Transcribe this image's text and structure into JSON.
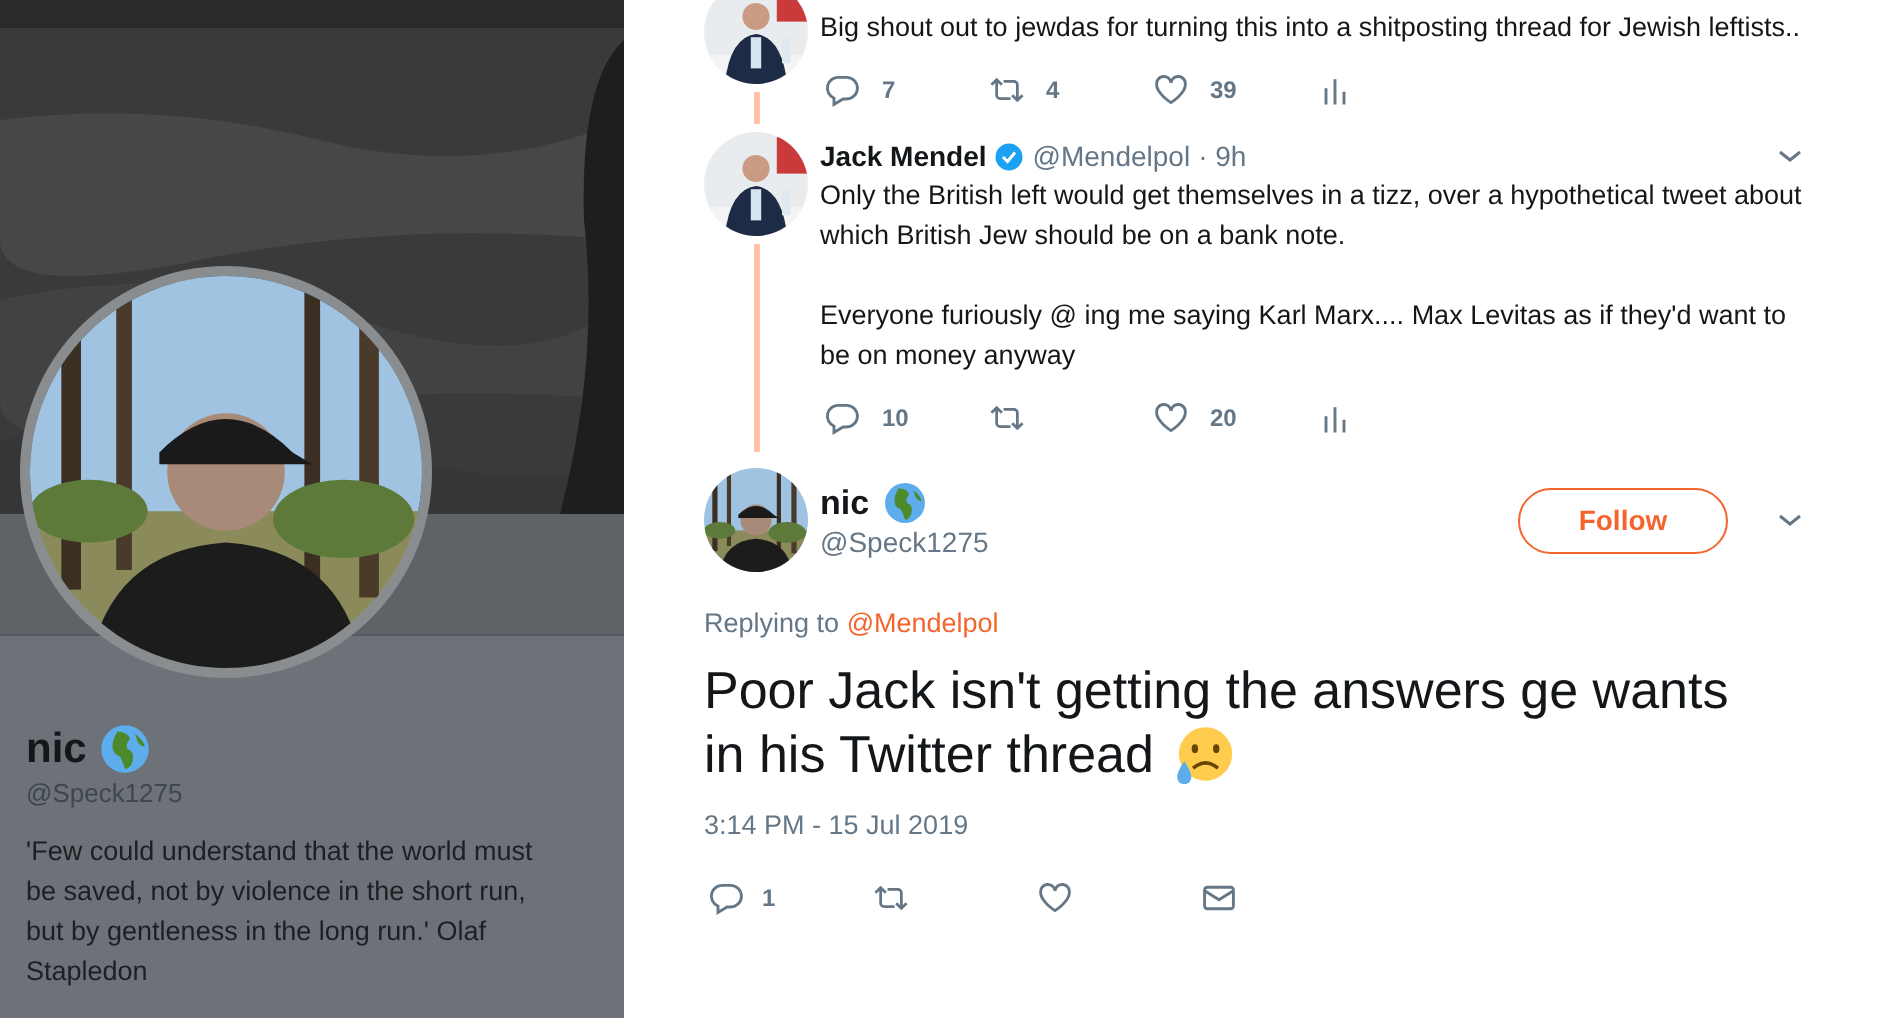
{
  "profile": {
    "name": "nic",
    "handle": "@Speck1275",
    "bio": "'Few could understand that the world must be saved, not by violence in the short run, but by gentleness in the long run.' Olaf Stapledon"
  },
  "thread": [
    {
      "text": [
        "Big shout out to jewdas for turning this into a shitposting thread for Jewish leftists.."
      ],
      "replies": "7",
      "retweets": "4",
      "likes": "39"
    },
    {
      "name": "Jack Mendel",
      "verified": true,
      "handle": "@Mendelpol",
      "time": "· 9h",
      "text": [
        "Only the British left would get themselves in a tizz, over a hypothetical tweet about which British Jew should be on a bank note.",
        "Everyone furiously @ ing me saying Karl Marx.... Max Levitas as if they'd want to be on money anyway"
      ],
      "replies": "10",
      "likes": "20"
    }
  ],
  "focused": {
    "name": "nic",
    "handle": "@Speck1275",
    "follow_label": "Follow",
    "replying_prefix": "Replying to",
    "reply_to": "@Mendelpol",
    "text": [
      "Poor Jack isn't getting the answers ge wants",
      "in his Twitter thread"
    ],
    "date": "3:14 PM - 15 Jul 2019",
    "replies": "1"
  }
}
